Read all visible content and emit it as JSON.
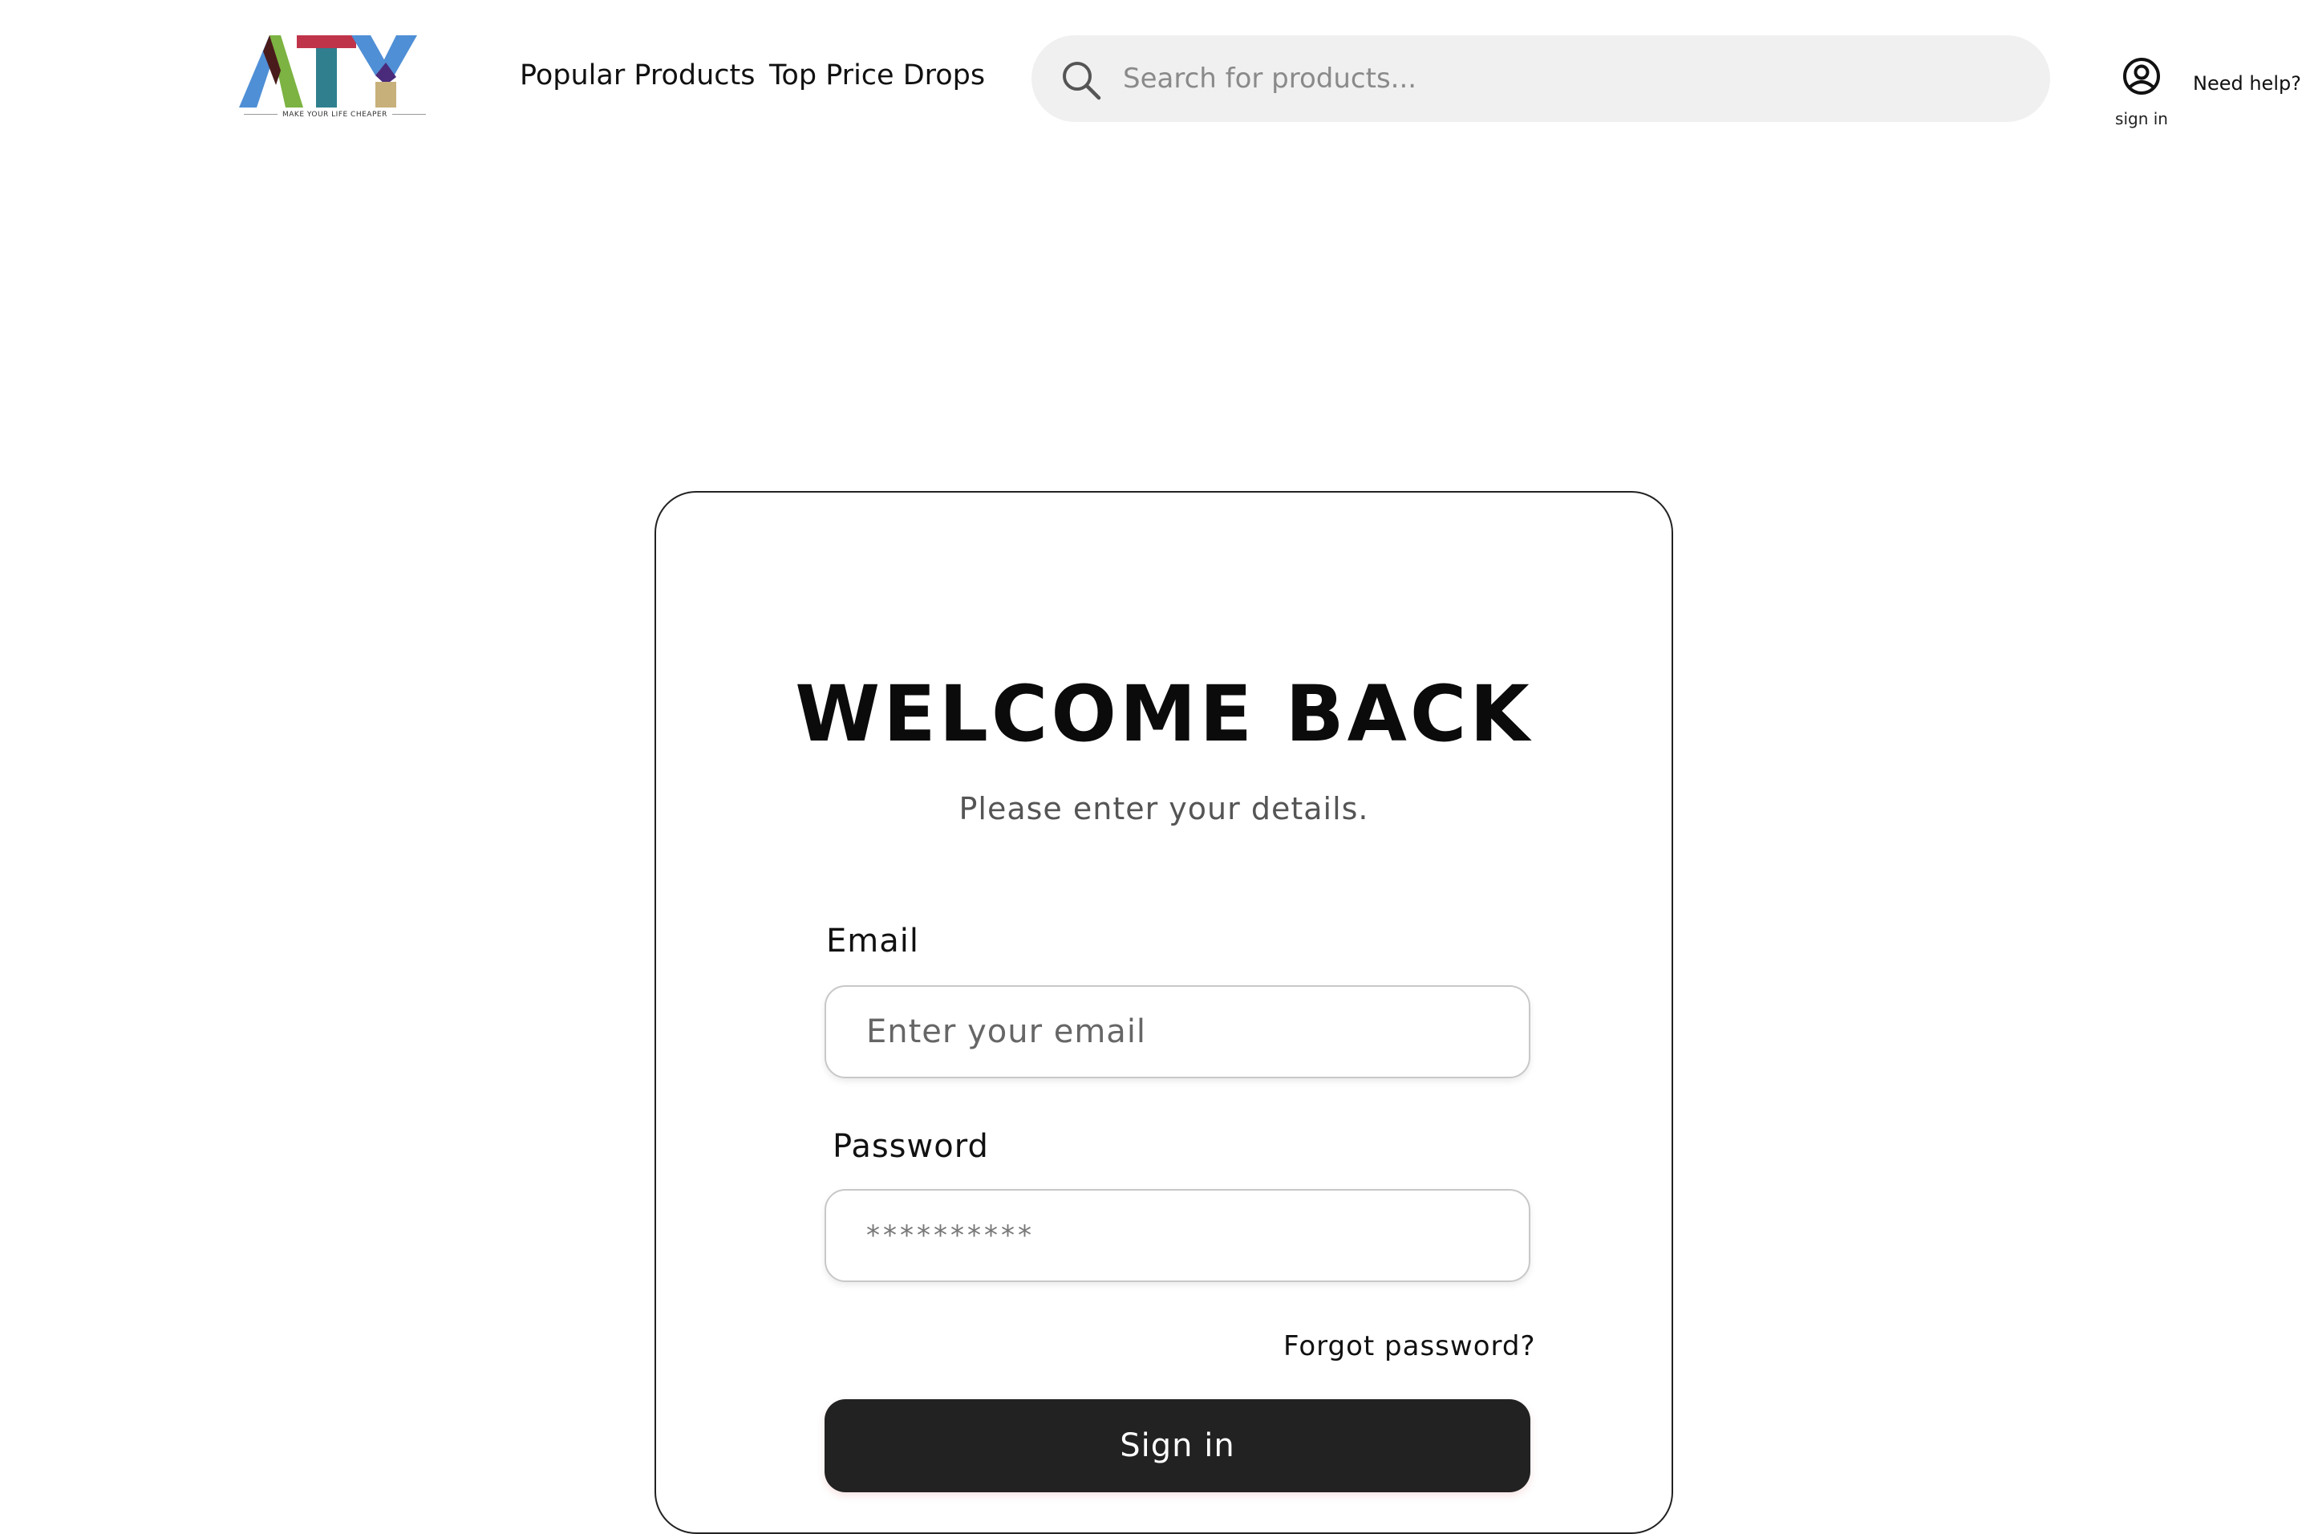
{
  "brand": {
    "logo_text": "ATY",
    "tagline": "MAKE YOUR LIFE CHEAPER"
  },
  "nav": {
    "popular_products": "Popular Products",
    "top_price_drops": "Top Price Drops"
  },
  "search": {
    "placeholder": "Search for products...",
    "value": ""
  },
  "account": {
    "sign_in_label": "sign in",
    "help_label": "Need help?"
  },
  "login": {
    "title": "WELCOME BACK",
    "subtitle": "Please enter your details.",
    "email_label": "Email",
    "email_placeholder": "Enter your email",
    "password_label": "Password",
    "password_placeholder": "**********",
    "forgot_password": "Forgot password?",
    "submit_label": "Sign in"
  },
  "icons": {
    "search": "search-icon",
    "user": "user-circle-icon"
  },
  "colors": {
    "button_bg": "#222222",
    "search_bg": "#f0f0f0",
    "logo_blue": "#4f8fd6",
    "logo_green": "#7cb342",
    "logo_red": "#c0344a",
    "logo_teal": "#2f7f8f",
    "logo_tan": "#c8b07a",
    "logo_purple": "#4a2a7a"
  }
}
